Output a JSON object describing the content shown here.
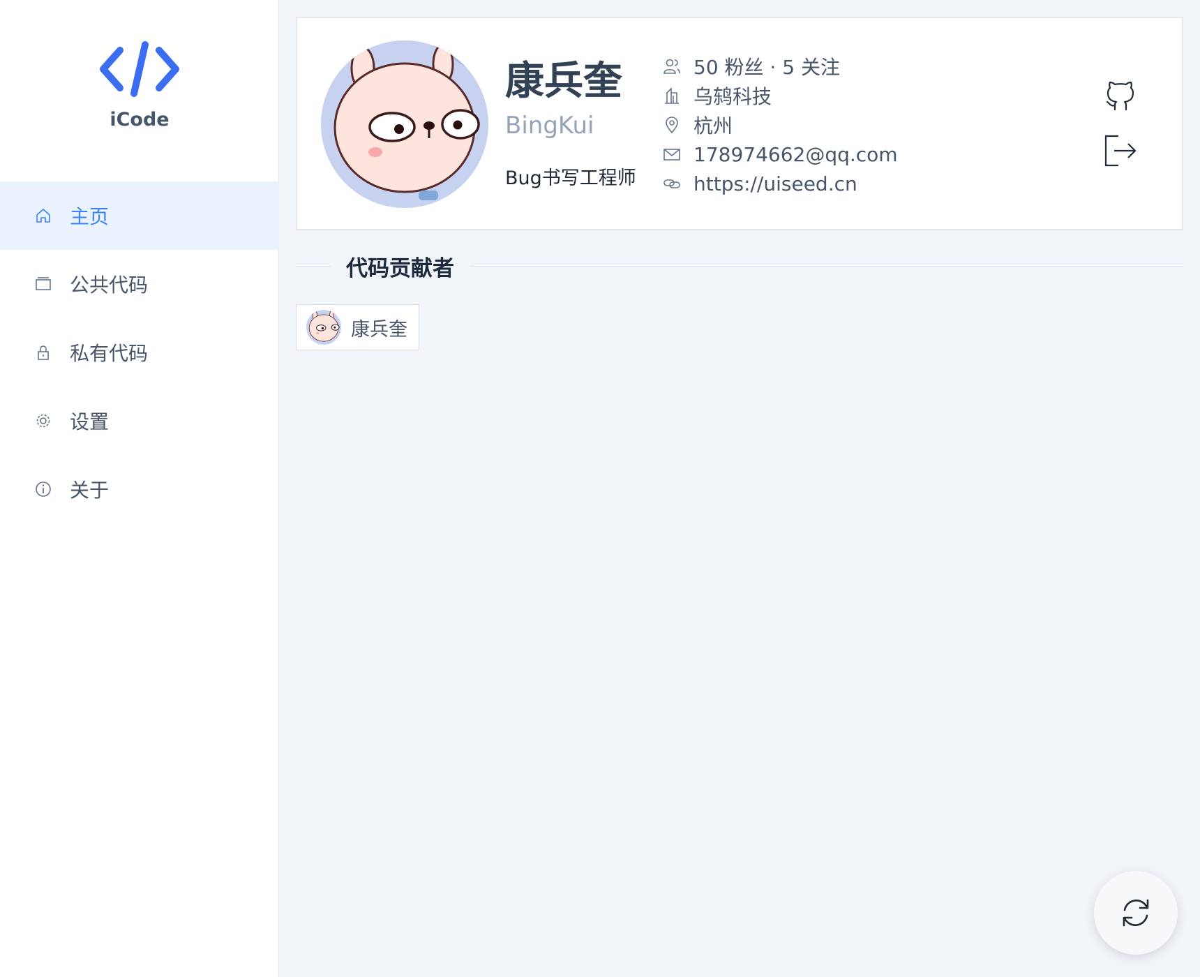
{
  "app": {
    "name": "iCode",
    "brand_color": "#3b6df0"
  },
  "sidebar": {
    "items": [
      {
        "label": "主页",
        "icon": "home-icon",
        "active": true
      },
      {
        "label": "公共代码",
        "icon": "folder-icon",
        "active": false
      },
      {
        "label": "私有代码",
        "icon": "lock-icon",
        "active": false
      },
      {
        "label": "设置",
        "icon": "gear-icon",
        "active": false
      },
      {
        "label": "关于",
        "icon": "info-icon",
        "active": false
      }
    ]
  },
  "profile": {
    "name": "康兵奎",
    "login": "BingKui",
    "bio": "Bug书写工程师",
    "followers_line": "50 粉丝 · 5 关注",
    "company": "乌鸫科技",
    "location": "杭州",
    "email": "178974662@qq.com",
    "blog": "https://uiseed.cn"
  },
  "section": {
    "title": "代码贡献者"
  },
  "contributors": [
    {
      "name": "康兵奎"
    }
  ],
  "actions": {
    "github_icon": "github-icon",
    "logout_icon": "logout-icon",
    "refresh_icon": "refresh-icon"
  }
}
